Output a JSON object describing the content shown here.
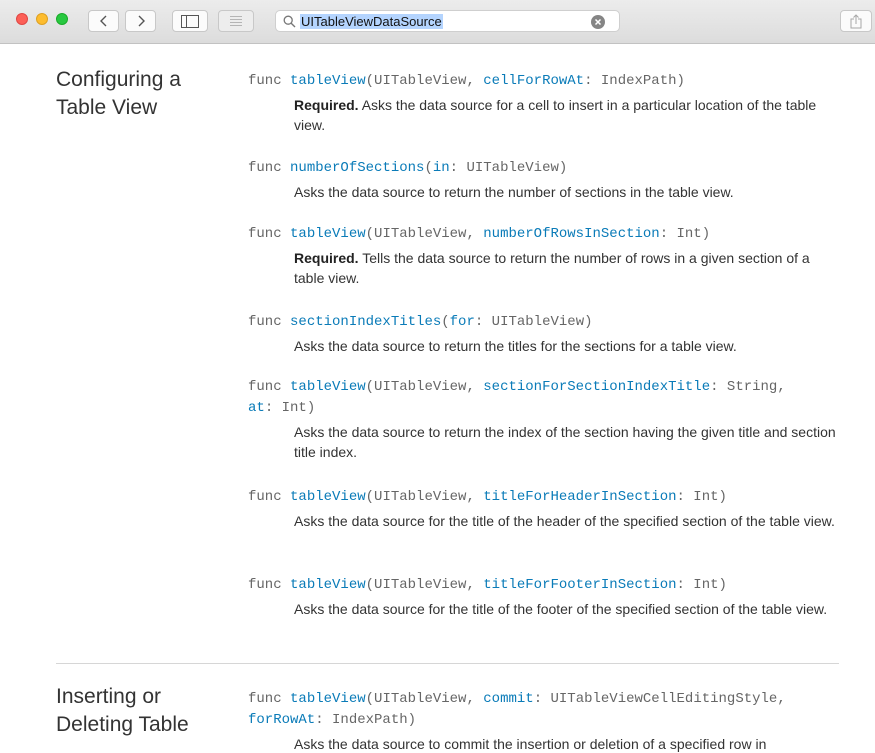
{
  "toolbar": {
    "search_query": "UITableViewDataSource"
  },
  "sections": [
    {
      "title_line1": "Configuring a",
      "title_line2": "Table View",
      "entries": [
        {
          "kw": "func",
          "name": "tableView",
          "p1": "(UITableView, ",
          "label": "cellForRowAt",
          "p2": ": IndexPath)",
          "req": "Required.",
          "desc": " Asks the data source for a cell to insert in a particular location of the table view."
        },
        {
          "kw": "func",
          "name": "numberOfSections",
          "p1": "(",
          "label": "in",
          "p2": ": UITableView)",
          "req": "",
          "desc": "Asks the data source to return the number of sections in the table view."
        },
        {
          "kw": "func",
          "name": "tableView",
          "p1": "(UITableView, ",
          "label": "numberOfRowsInSection",
          "p2": ": Int)",
          "req": "Required.",
          "desc": " Tells the data source to return the number of rows in a given section of a table view."
        },
        {
          "kw": "func",
          "name": "sectionIndexTitles",
          "p1": "(",
          "label": "for",
          "p2": ": UITableView)",
          "req": "",
          "desc": "Asks the data source to return the titles for the sections for a table view."
        },
        {
          "kw": "func",
          "name": "tableView",
          "p1": "(UITableView, ",
          "label": "sectionForSectionIndexTitle",
          "p2": ": String, ",
          "label2": "at",
          "p3": ": Int)",
          "req": "",
          "desc": "Asks the data source to return the index of the section having the given title and section title index."
        },
        {
          "kw": "func",
          "name": "tableView",
          "p1": "(UITableView, ",
          "label": "titleForHeaderInSection",
          "p2": ": Int)",
          "req": "",
          "desc": "Asks the data source for the title of the header of the specified section of the table view."
        },
        {
          "kw": "func",
          "name": "tableView",
          "p1": "(UITableView, ",
          "label": "titleForFooterInSection",
          "p2": ": Int)",
          "req": "",
          "desc": "Asks the data source for the title of the footer of the specified section of the table view."
        }
      ]
    },
    {
      "title_line1": "Inserting or",
      "title_line2": "Deleting Table",
      "entries": [
        {
          "kw": "func",
          "name": "tableView",
          "p1": "(UITableView, ",
          "label": "commit",
          "p2": ": UITableViewCellEditingStyle, ",
          "label2": "forRowAt",
          "p3": ": IndexPath)",
          "req": "",
          "desc": "Asks the data source to commit the insertion or deletion of a specified row in"
        }
      ]
    }
  ]
}
